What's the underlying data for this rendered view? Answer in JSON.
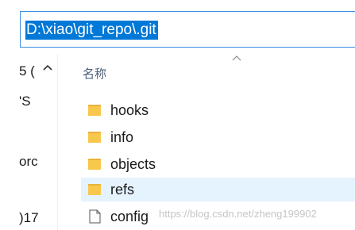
{
  "address_bar": {
    "path": "D:\\xiao\\git_repo\\.git"
  },
  "navigation_pane": {
    "fragments": [
      "5 (",
      "'S",
      "orc",
      ")17"
    ]
  },
  "file_list": {
    "header_name": "名称",
    "items": [
      {
        "name": "hooks",
        "type": "folder",
        "selected": false
      },
      {
        "name": "info",
        "type": "folder",
        "selected": false
      },
      {
        "name": "objects",
        "type": "folder",
        "selected": false
      },
      {
        "name": "refs",
        "type": "folder",
        "selected": true
      },
      {
        "name": "config",
        "type": "file",
        "selected": false
      }
    ]
  },
  "watermark": "https://blog.csdn.net/zheng199902",
  "colors": {
    "selection_highlight": "#0078d7",
    "row_hover": "#e5f3ff",
    "folder_yellow": "#f8c84c",
    "header_text": "#4c607a"
  }
}
